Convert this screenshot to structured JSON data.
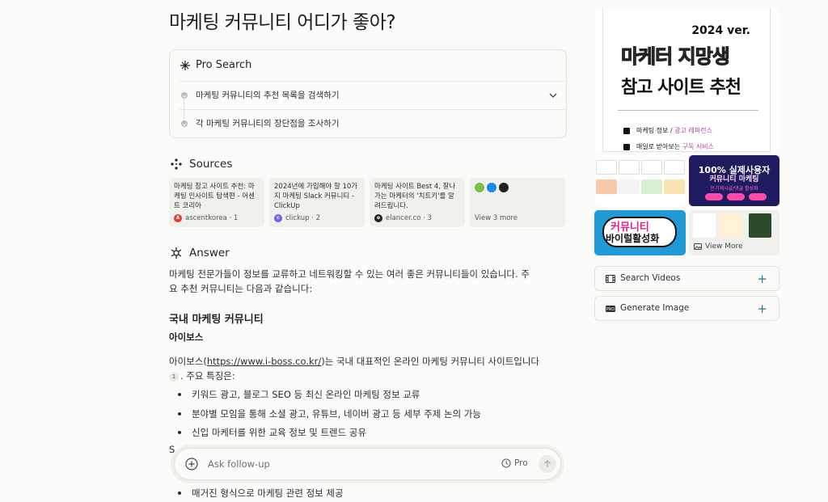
{
  "question": "마케팅 커뮤니티 어디가 좋아?",
  "pro_search": {
    "title": "Pro Search",
    "steps": [
      "마케팅 커뮤니티의 추천 목록을 검색하기",
      "각 마케팅 커뮤니티의 장단점을 조사하기"
    ]
  },
  "sources": {
    "title": "Sources",
    "items": [
      {
        "title": "마케팅 참고 사이트 추천: 마케팅 인사이트 탐색편 - 어센트 코리아",
        "site": "ascentkorea · 1",
        "color": "#e5392f"
      },
      {
        "title": "2024년에 가입해야 할 10가지 마케팅 Slack 커뮤니티 - ClickUp",
        "site": "clickup · 2",
        "color": "#7b5cf0"
      },
      {
        "title": "마케팅 사이트 Best 4, 잘나가는 마케터의 '치트키'를 알려드립니다.",
        "site": "elancer.co · 3",
        "color": "#222222"
      }
    ],
    "more_label": "View 3 more"
  },
  "answer": {
    "title": "Answer",
    "intro_1": "마케팅 전문가들이 정보를 교류하고 네트워킹할 수 있는 여러 좋은 커뮤니티들이 있습니다. 주",
    "intro_2": "요 추천 커뮤니티는 다음과 같습니다:",
    "section_heading": "국내 마케팅 커뮤니티",
    "sub_heading": "아이보스",
    "para_prefix": "아이보스(",
    "para_link": "https://www.i-boss.co.kr/",
    "para_suffix": ")는 국내 대표적인 온라인 마케팅 커뮤니티 사이트입니다",
    "cite": "1",
    "para_2": ". 주요 특징은:",
    "bullets": [
      "키워드 광고, 블로그 SEO 등 최신 온라인 마케팅 정보 교류",
      "분야별 모임을 통해 소셜 광고, 유튜브, 네이버 광고 등 세부 주제 논의 가능",
      "신입 마케터를 위한 교육 정보 및 트렌드 공유"
    ],
    "peek_s": "S",
    "peek_bullet": "매거진 형식으로 마케팅 관련 정보 제공"
  },
  "followup": {
    "placeholder": "Ask follow-up",
    "pro_label": "Pro"
  },
  "media": {
    "hero": {
      "year": "2024 ver.",
      "line1": "마케터 지망생",
      "line2": "참고 사이트 추천",
      "check1_a": "마케팅 정보 / ",
      "check1_b": "광고 레퍼런스",
      "check2_a": "매일로 받아보는 ",
      "check2_b": "구독 서비스"
    },
    "thumb2_big": "100% 실제사용자",
    "thumb2_line": "커뮤니티 마케팅",
    "thumb2_sub": "인기게시글/댓글 활성화",
    "thumb3_line1": "커뮤니티",
    "thumb3_line2": "바이럴활성화",
    "view_more": "View More",
    "search_videos": "Search Videos",
    "generate_image": "Generate Image"
  }
}
